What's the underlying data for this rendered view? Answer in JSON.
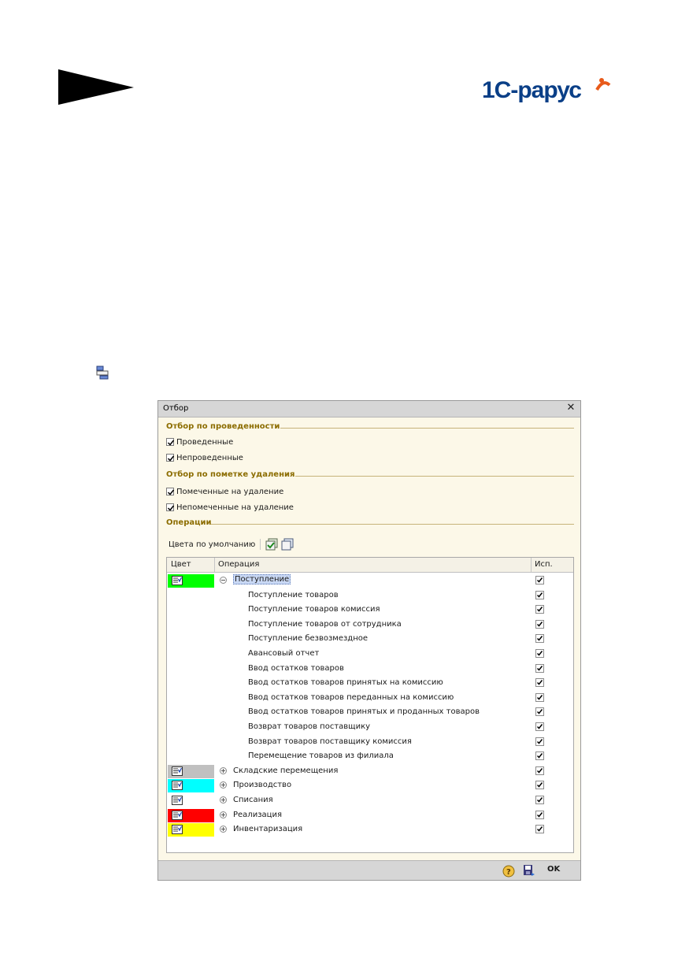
{
  "brand": {
    "logo_text": "1С-рарус"
  },
  "dialog": {
    "title": "Отбор",
    "section_posting": "Отбор по проведенности",
    "posted_label": "Проведенные",
    "unposted_label": "Непроведенные",
    "section_deletion": "Отбор по пометке удаления",
    "marked_label": "Помеченные на удаление",
    "unmarked_label": "Непомеченные на удаление",
    "section_operations": "Операции",
    "toolbar_default_colors": "Цвета по умолчанию",
    "columns": {
      "color": "Цвет",
      "operation": "Операция",
      "use": "Исп."
    },
    "ok_label": "OK"
  },
  "rows": [
    {
      "name": "Поступление",
      "level": 0,
      "expanded": true,
      "color": "#00ff00",
      "checked": true
    },
    {
      "name": "Поступление товаров",
      "level": 1,
      "checked": true
    },
    {
      "name": "Поступление товаров комиссия",
      "level": 1,
      "checked": true
    },
    {
      "name": "Поступление товаров от сотрудника",
      "level": 1,
      "checked": true
    },
    {
      "name": "Поступление безвозмездное",
      "level": 1,
      "checked": true
    },
    {
      "name": "Авансовый отчет",
      "level": 1,
      "checked": true
    },
    {
      "name": "Ввод остатков товаров",
      "level": 1,
      "checked": true
    },
    {
      "name": "Ввод остатков товаров принятых на комиссию",
      "level": 1,
      "checked": true
    },
    {
      "name": "Ввод остатков товаров переданных на комиссию",
      "level": 1,
      "checked": true
    },
    {
      "name": "Ввод остатков товаров принятых и проданных товаров",
      "level": 1,
      "checked": true
    },
    {
      "name": "Возврат товаров поставщику",
      "level": 1,
      "checked": true
    },
    {
      "name": "Возврат товаров поставщику комиссия",
      "level": 1,
      "checked": true
    },
    {
      "name": "Перемещение товаров из филиала",
      "level": 1,
      "checked": true
    },
    {
      "name": "Складские перемещения",
      "level": 0,
      "expanded": false,
      "color": "#c0c0c0",
      "checked": true
    },
    {
      "name": "Производство",
      "level": 0,
      "expanded": false,
      "color": "#00ffff",
      "checked": true
    },
    {
      "name": "Списания",
      "level": 0,
      "expanded": false,
      "color": "#ffffff",
      "checked": true
    },
    {
      "name": "Реализация",
      "level": 0,
      "expanded": false,
      "color": "#ff0000",
      "checked": true
    },
    {
      "name": "Инвентаризация",
      "level": 0,
      "expanded": false,
      "color": "#ffff00",
      "checked": true
    }
  ]
}
